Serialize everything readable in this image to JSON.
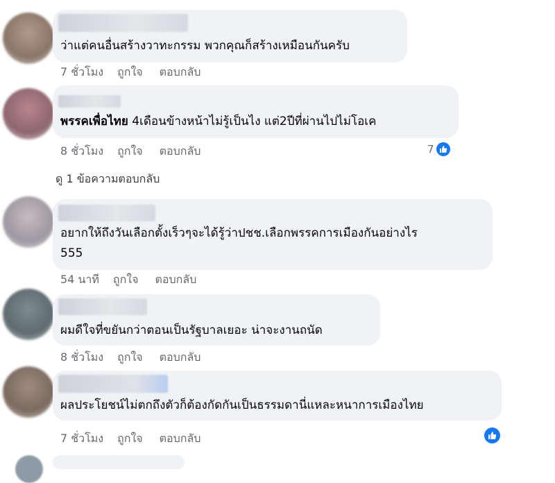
{
  "comments": [
    {
      "text": "ว่าแต่คนอื่นสร้างวาทะกรรม พวกคุณก็สร้างเหมือนกันครับ",
      "time": "7 ชั่วโมง",
      "like": "ถูกใจ",
      "reply": "ตอบกลับ"
    },
    {
      "party": "พรรคเพื่อไทย",
      "text": " 4เดือนข้างหน้าไม่รู้เป็นไง แต่2ปีที่ผ่านไปไม่โอเค",
      "time": "8 ชั่วโมง",
      "like": "ถูกใจ",
      "reply": "ตอบกลับ",
      "reactions": "7",
      "view_replies": "ดู 1 ข้อความตอบกลับ"
    },
    {
      "text_line1": "อยากให้ถึงวันเลือกตั้งเร็วๆจะได้รู้ว่าปชช.เลือกพรรคการเมืองกันอย่างไร",
      "text_line2": "555",
      "time": "54 นาที",
      "like": "ถูกใจ",
      "reply": "ตอบกลับ"
    },
    {
      "text": "ผมดีใจที่ขยันกว่าตอนเป็นรัฐบาลเยอะ น่าจะงานถนัด",
      "time": "8 ชั่วโมง",
      "like": "ถูกใจ",
      "reply": "ตอบกลับ"
    },
    {
      "text": "ผลประโยชน์ไม่ตกถึงตัวก็ต้องกัดกันเป็นธรรมดานี่แหละหนาการเมืองไทย",
      "time": "7 ชั่วโมง",
      "like": "ถูกใจ",
      "reply": "ตอบกลับ"
    }
  ],
  "colors": {
    "bubble": "#f0f2f5",
    "meta": "#65676b",
    "like_blue": "#1877f2"
  },
  "icons": [
    "like-icon",
    "avatar"
  ]
}
